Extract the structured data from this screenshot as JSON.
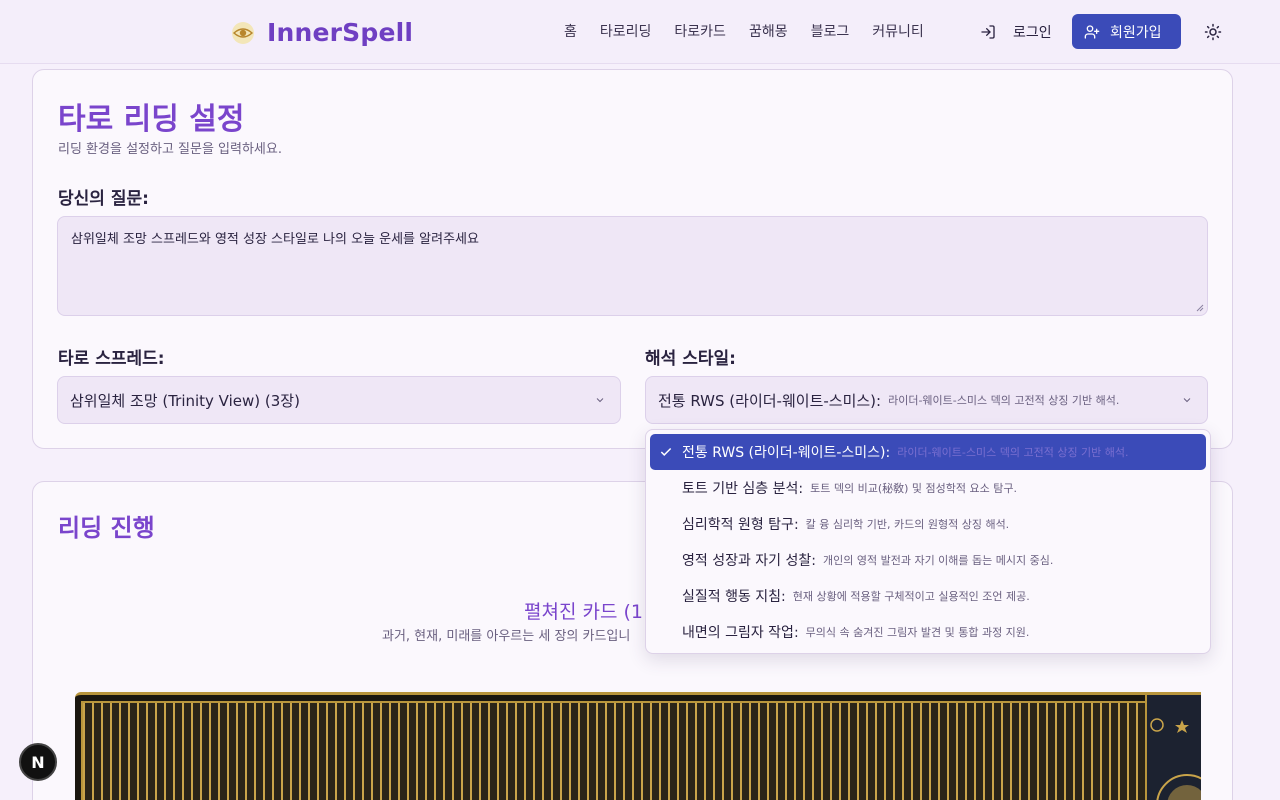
{
  "header": {
    "logo_text": "InnerSpell",
    "nav": [
      "홈",
      "타로리딩",
      "타로카드",
      "꿈해몽",
      "블로그",
      "커뮤니티"
    ],
    "login_label": "로그인",
    "signup_label": "회원가입",
    "icons": {
      "logo": "eye-logo-icon",
      "login": "login-icon",
      "signup": "user-plus-icon",
      "theme": "sun-icon"
    }
  },
  "settings": {
    "title": "타로 리딩 설정",
    "subtitle": "리딩 환경을 설정하고 질문을 입력하세요.",
    "question_label": "당신의 질문:",
    "question_value": "삼위일체 조망 스프레드와 영적 성장 스타일로 나의 오늘 운세를 알려주세요",
    "spread_label": "타로 스프레드:",
    "spread_value": "삼위일체 조망 (Trinity View) (3장)",
    "style_label": "해석 스타일:",
    "style_value_main": "전통 RWS (라이더-웨이트-스미스):",
    "style_value_desc": "라이더-웨이트-스미스 덱의 고전적 상징 기반 해석."
  },
  "style_options": [
    {
      "main": "전통 RWS (라이더-웨이트-스미스):",
      "desc": "라이더-웨이트-스미스 덱의 고전적 상징 기반 해석.",
      "selected": true
    },
    {
      "main": "토트 기반 심층 분석:",
      "desc": "토트 덱의 비교(秘敎) 및 점성학적 요소 탐구.",
      "selected": false
    },
    {
      "main": "심리학적 원형 탐구:",
      "desc": "칼 융 심리학 기반, 카드의 원형적 상징 해석.",
      "selected": false
    },
    {
      "main": "영적 성장과 자기 성찰:",
      "desc": "개인의 영적 발전과 자기 이해를 돕는 메시지 중심.",
      "selected": false
    },
    {
      "main": "실질적 행동 지침:",
      "desc": "현재 상황에 적용할 구체적이고 실용적인 조언 제공.",
      "selected": false
    },
    {
      "main": "내면의 그림자 작업:",
      "desc": "무의식 속 숨겨진 그림자 발견 및 통합 과정 지원.",
      "selected": false
    }
  ],
  "progress": {
    "title": "리딩 진행",
    "spread_title": "펼쳐진 카드 (1",
    "spread_desc": "과거, 현재, 미래를 아우르는 세 장의 카드입니"
  },
  "badge": "N",
  "colors": {
    "accent": "#7a45cc",
    "primary": "#3b4bb8",
    "background": "#f6f0fb"
  }
}
